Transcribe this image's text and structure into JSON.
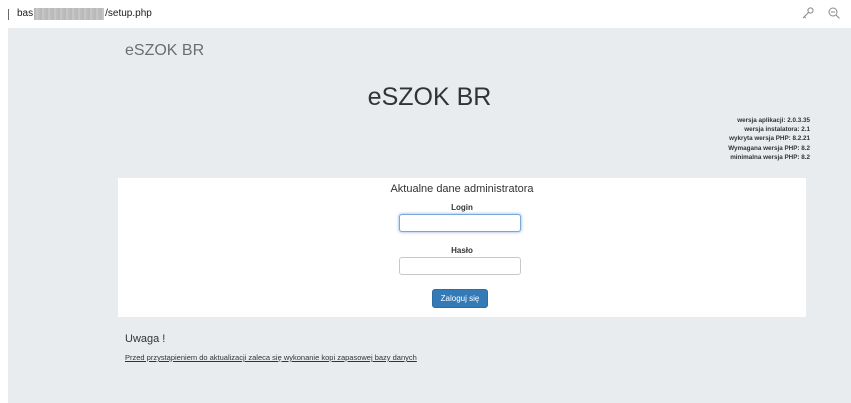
{
  "browser": {
    "url_prefix": "bas",
    "url_suffix": "/setup.php",
    "icons": [
      "key-icon",
      "zoom-icon"
    ]
  },
  "header": {
    "brand": "eSZOK BR"
  },
  "hero": {
    "title": "eSZOK BR"
  },
  "versions": {
    "app": "wersja aplikacji: 2.0.3.35",
    "installer": "wersja instalatora: 2.1",
    "php_detected": "wykryta wersja PHP: 8.2.21",
    "php_required": "Wymagana wersja PHP: 8.2",
    "php_minimum": "minimalna wersja PHP: 8.2"
  },
  "admin_form": {
    "title": "Aktualne dane administratora",
    "login_label": "Login",
    "login_value": "",
    "password_label": "Hasło",
    "password_value": "",
    "submit_label": "Zaloguj się"
  },
  "notice": {
    "title": "Uwaga !",
    "link_text": "Przed przystąpieniem do aktualizacji zaleca się wykonanie kopi zapasowej bazy danych"
  },
  "colors": {
    "page_background": "#e8ecef",
    "primary_button": "#337ab7",
    "card_background": "#ffffff"
  }
}
